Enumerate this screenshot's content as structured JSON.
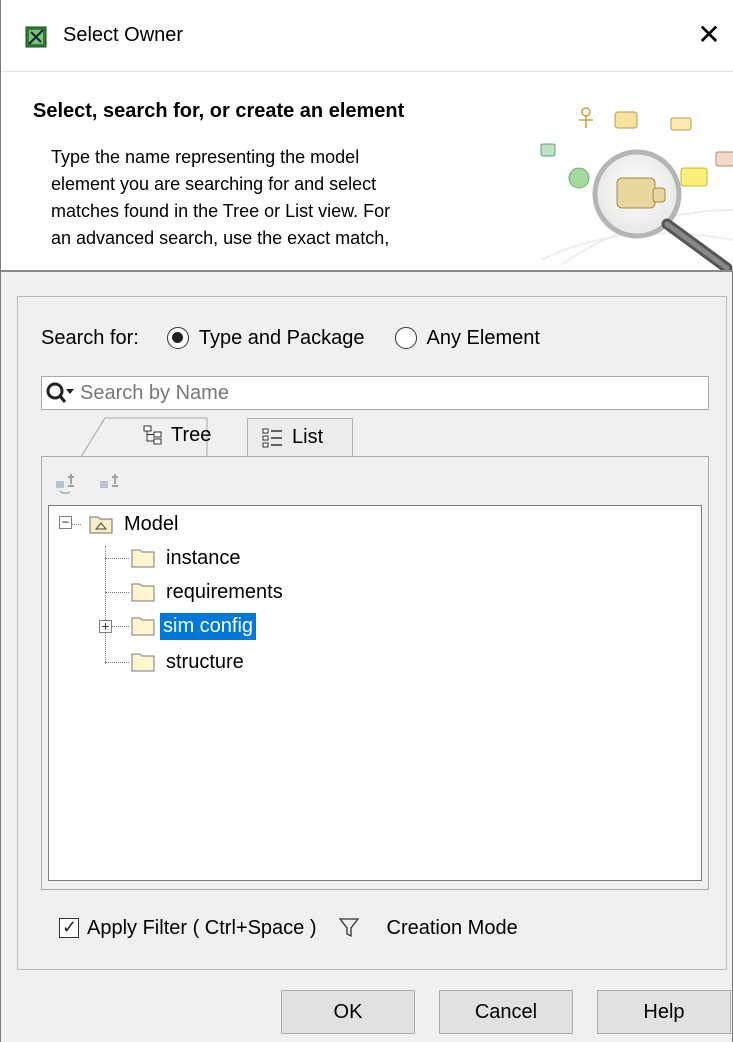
{
  "window": {
    "title": "Select Owner",
    "close_glyph": "✕"
  },
  "banner": {
    "heading": "Select, search for, or create an element",
    "description": "Type the name representing the model\nelement you are searching for and select\nmatches found in the Tree or List view. For\nan advanced search, use the exact match,"
  },
  "search_for": {
    "label": "Search for:",
    "options": [
      {
        "label": "Type and Package",
        "checked": true
      },
      {
        "label": "Any Element",
        "checked": false
      }
    ]
  },
  "search": {
    "placeholder": "Search by Name",
    "value": ""
  },
  "tabs": [
    {
      "label": "Tree",
      "active": true,
      "icon": "tree-icon"
    },
    {
      "label": "List",
      "active": false,
      "icon": "list-icon"
    }
  ],
  "tree": {
    "root": {
      "label": "Model",
      "expanded": true,
      "icon": "model-package-icon"
    },
    "children": [
      {
        "label": "instance",
        "icon": "folder-icon",
        "expandable": false,
        "selected": false
      },
      {
        "label": "requirements",
        "icon": "folder-icon",
        "expandable": false,
        "selected": false
      },
      {
        "label": "sim config",
        "icon": "folder-icon",
        "expandable": true,
        "selected": true
      },
      {
        "label": "structure",
        "icon": "folder-icon",
        "expandable": false,
        "selected": false
      }
    ]
  },
  "filter": {
    "apply_label": "Apply Filter ( Ctrl+Space )",
    "apply_checked": true,
    "creation_mode_label": "Creation Mode"
  },
  "buttons": {
    "ok": "OK",
    "cancel": "Cancel",
    "help": "Help"
  },
  "colors": {
    "selection": "#0078d7",
    "window_bg": "#f0f0f0"
  }
}
